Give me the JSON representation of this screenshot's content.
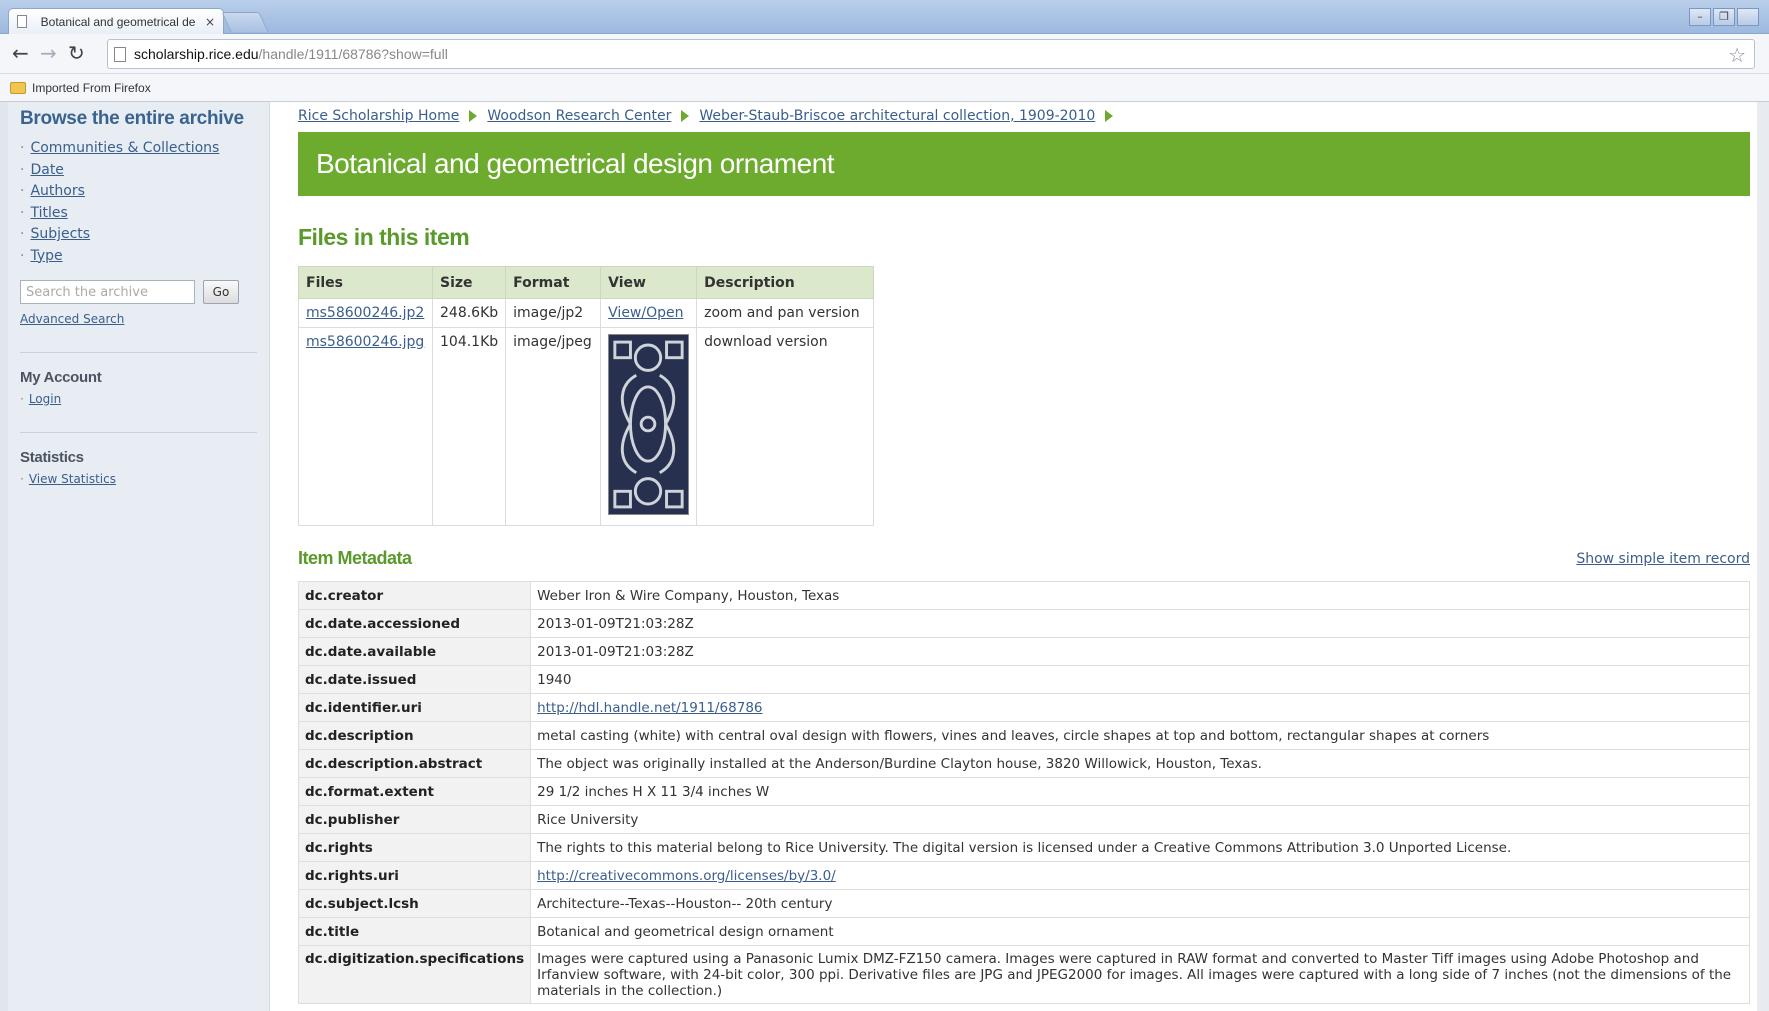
{
  "browser": {
    "tab_title": "Botanical and geometrical de",
    "tab_close": "×",
    "url_host": "scholarship.rice.edu",
    "url_path": "/handle/1911/68786?show=full",
    "bookmark_folder": "Imported From Firefox",
    "icons": [
      "back-arrow-icon",
      "forward-arrow-icon",
      "reload-icon",
      "page-icon",
      "star-icon",
      "folder-icon"
    ]
  },
  "sidebar": {
    "title": "Browse the entire archive",
    "browse_items": [
      {
        "label": "Communities & Collections"
      },
      {
        "label": "Date"
      },
      {
        "label": "Authors"
      },
      {
        "label": "Titles"
      },
      {
        "label": "Subjects"
      },
      {
        "label": "Type"
      }
    ],
    "search_placeholder": "Search the archive",
    "go_label": "Go",
    "advanced_search": "Advanced Search",
    "account_heading": "My Account",
    "login_label": "Login",
    "statistics_heading": "Statistics",
    "view_statistics": "View Statistics"
  },
  "breadcrumb": [
    "Rice Scholarship Home",
    "Woodson Research Center",
    "Weber-Staub-Briscoe architectural collection, 1909-2010"
  ],
  "item_title": "Botanical and geometrical design ornament",
  "files": {
    "heading": "Files in this item",
    "columns": [
      "Files",
      "Size",
      "Format",
      "View",
      "Description"
    ],
    "rows": [
      {
        "file": "ms58600246.jp2",
        "size": "248.6Kb",
        "format": "image/jp2",
        "view": "View/Open",
        "description": "zoom and pan version"
      },
      {
        "file": "ms58600246.jpg",
        "size": "104.1Kb",
        "format": "image/jpeg",
        "view": "",
        "description": "download version"
      }
    ]
  },
  "metadata": {
    "heading": "Item Metadata",
    "simple_record_link": "Show simple item record",
    "rows": [
      {
        "key": "dc.creator",
        "value": "Weber Iron & Wire Company, Houston, Texas",
        "link": false
      },
      {
        "key": "dc.date.accessioned",
        "value": "2013-01-09T21:03:28Z",
        "link": false
      },
      {
        "key": "dc.date.available",
        "value": "2013-01-09T21:03:28Z",
        "link": false
      },
      {
        "key": "dc.date.issued",
        "value": "1940",
        "link": false
      },
      {
        "key": "dc.identifier.uri",
        "value": "http://hdl.handle.net/1911/68786",
        "link": true
      },
      {
        "key": "dc.description",
        "value": "metal casting (white) with central oval design with flowers, vines and leaves, circle shapes at top and bottom, rectangular shapes at corners",
        "link": false
      },
      {
        "key": "dc.description.abstract",
        "value": "The object was originally installed at the Anderson/Burdine Clayton house, 3820 Willowick, Houston, Texas.",
        "link": false
      },
      {
        "key": "dc.format.extent",
        "value": "29 1/2 inches H X 11 3/4 inches W",
        "link": false
      },
      {
        "key": "dc.publisher",
        "value": "Rice University",
        "link": false
      },
      {
        "key": "dc.rights",
        "value": "The rights to this material belong to Rice University. The digital version is licensed under a Creative Commons Attribution 3.0 Unported License.",
        "link": false
      },
      {
        "key": "dc.rights.uri",
        "value": "http://creativecommons.org/licenses/by/3.0/",
        "link": true
      },
      {
        "key": "dc.subject.lcsh",
        "value": "Architecture--Texas--Houston-- 20th century",
        "link": false
      },
      {
        "key": "dc.title",
        "value": "Botanical and geometrical design ornament",
        "link": false
      },
      {
        "key": "dc.digitization.specifications",
        "value": "Images were captured using a Panasonic Lumix DMZ-FZ150 camera. Images were captured in RAW format and converted to Master Tiff images using Adobe Photoshop and Irfanview software, with 24-bit color, 300 ppi. Derivative files are JPG and JPEG2000 for images. All images were captured with a long side of 7 inches (not the dimensions of the materials in the collection.)",
        "link": false
      }
    ]
  },
  "colors": {
    "accent_green": "#6cab2e",
    "heading_green": "#5a9a2a",
    "sidebar_title": "#3a648f",
    "link": "#3b5e8c"
  }
}
